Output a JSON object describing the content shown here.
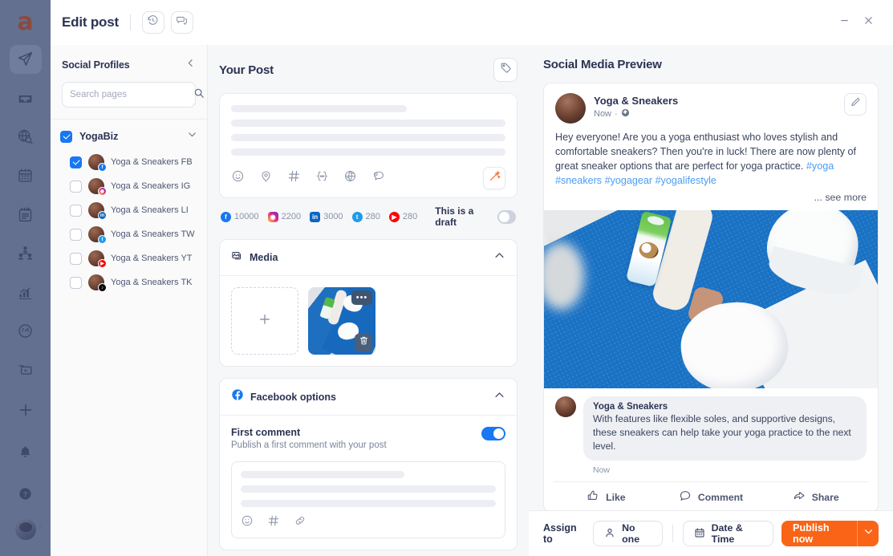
{
  "app": {
    "logo_text": "a",
    "title": "Edit post",
    "rail_items": [
      {
        "name": "publish",
        "icon": "paper-plane-icon",
        "active": true
      },
      {
        "name": "inbox",
        "icon": "inbox-icon",
        "active": false
      },
      {
        "name": "monitoring",
        "icon": "globe-search-icon",
        "active": false
      },
      {
        "name": "calendar",
        "icon": "calendar-icon",
        "active": false
      },
      {
        "name": "reports",
        "icon": "notepad-icon",
        "active": false
      },
      {
        "name": "audience",
        "icon": "people-icon",
        "active": false
      },
      {
        "name": "analytics",
        "icon": "bar-chart-icon",
        "active": false
      },
      {
        "name": "dashboard",
        "icon": "speedometer-icon",
        "active": false
      },
      {
        "name": "media-library",
        "icon": "video-folder-icon",
        "active": false
      }
    ],
    "rail_bottom": [
      {
        "name": "create",
        "icon": "plus-icon"
      },
      {
        "name": "notifications",
        "icon": "bell-icon"
      },
      {
        "name": "help",
        "icon": "question-circle-icon"
      }
    ],
    "window_controls": {
      "minimize": "minimize-icon",
      "close": "close-icon"
    },
    "header_buttons": [
      {
        "name": "history",
        "icon": "history-icon"
      },
      {
        "name": "comments",
        "icon": "comments-icon"
      }
    ]
  },
  "profiles": {
    "title": "Social Profiles",
    "collapse_icon": "chevron-left-icon",
    "search": {
      "placeholder": "Search pages",
      "value": "",
      "icon": "search-icon"
    },
    "group": {
      "name": "YogaBiz",
      "checked": true,
      "expand_icon": "chevron-down-icon"
    },
    "accounts": [
      {
        "label": "Yoga & Sneakers FB",
        "network": "fb",
        "checked": true
      },
      {
        "label": "Yoga & Sneakers IG",
        "network": "ig",
        "checked": false
      },
      {
        "label": "Yoga & Sneakers LI",
        "network": "li",
        "checked": false
      },
      {
        "label": "Yoga & Sneakers TW",
        "network": "tw",
        "checked": false
      },
      {
        "label": "Yoga & Sneakers YT",
        "network": "yt",
        "checked": false
      },
      {
        "label": "Yoga & Sneakers TK",
        "network": "tk",
        "checked": false
      }
    ]
  },
  "post": {
    "title": "Your Post",
    "tag_button_icon": "tag-icon",
    "toolbar_icons": [
      "emoji-icon",
      "location-pin-icon",
      "hashtag-icon",
      "variable-icon",
      "globe-icon",
      "chat-bubble-icon"
    ],
    "magic_button_icon": "magic-wand-icon",
    "counts": [
      {
        "network": "fb",
        "value": "10000"
      },
      {
        "network": "ig",
        "value": "2200"
      },
      {
        "network": "li",
        "value": "3000"
      },
      {
        "network": "tw",
        "value": "280"
      },
      {
        "network": "yt",
        "value": "280"
      }
    ],
    "draft": {
      "label": "This is a draft",
      "on": false
    }
  },
  "media": {
    "title": "Media",
    "icon": "images-icon",
    "collapse_icon": "chevron-up-icon",
    "add_icon": "plus-icon",
    "thumb_more_icon": "ellipsis-icon",
    "thumb_delete_icon": "trash-icon"
  },
  "facebook_options": {
    "title": "Facebook options",
    "icon": "facebook-icon",
    "collapse_icon": "chevron-up-icon",
    "first_comment": {
      "title": "First comment",
      "subtitle": "Publish a first comment with your post",
      "toggle_on": true
    },
    "comment_toolbar_icons": [
      "emoji-icon",
      "hashtag-icon",
      "link-icon"
    ]
  },
  "preview": {
    "title": "Social Media Preview",
    "edit_icon": "pencil-icon",
    "author": "Yoga & Sneakers",
    "time": "Now",
    "privacy_icon": "globe-icon",
    "separator": "·",
    "body_text": "Hey everyone! Are you a yoga enthusiast who loves stylish and comfortable sneakers? Then you're in luck! There are now plenty of great sneaker options that are perfect for yoga practice. ",
    "hashtags": "#yoga #sneakers #yogagear #yogalifestyle",
    "see_more": "... see more",
    "comment": {
      "author": "Yoga & Sneakers",
      "text": "With features like flexible soles, and supportive designs, these sneakers can help take your yoga practice to the next level.",
      "time": "Now"
    },
    "actions": [
      {
        "label": "Like",
        "icon": "thumbs-up-icon"
      },
      {
        "label": "Comment",
        "icon": "comment-icon"
      },
      {
        "label": "Share",
        "icon": "share-icon"
      }
    ]
  },
  "actionbar": {
    "assign_label": "Assign to",
    "assignee": {
      "label": "No one",
      "icon": "person-icon"
    },
    "schedule": {
      "label": "Date & Time",
      "icon": "calendar-icon"
    },
    "publish": {
      "label": "Publish now",
      "caret_icon": "chevron-down-icon"
    }
  },
  "colors": {
    "rail_bg": "#64708f",
    "accent_orange": "#f96416",
    "facebook_blue": "#1877f2",
    "hashtag_blue": "#4a9df7",
    "text_dark": "#2b3353"
  }
}
